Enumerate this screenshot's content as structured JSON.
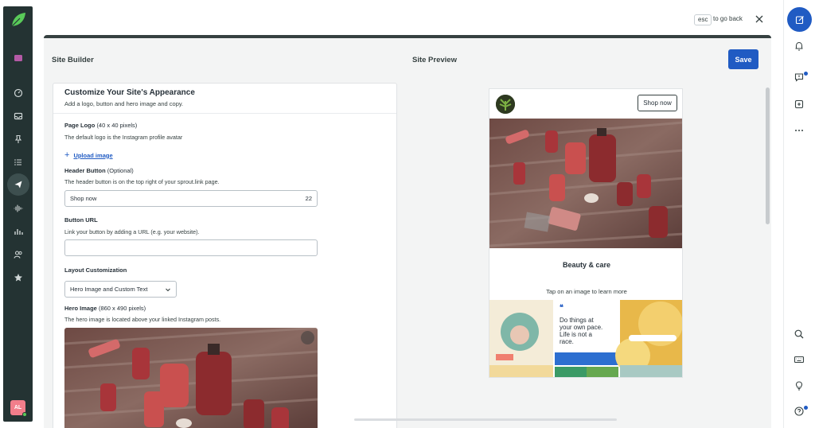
{
  "window": {
    "esc_key": "esc",
    "go_back": "to go back"
  },
  "colors": {
    "nav_bg": "#243333",
    "brand_green": "#59cb59",
    "primary_blue": "#205bc3"
  },
  "left_nav": {
    "items": [
      {
        "name": "compose-folder-icon"
      },
      {
        "name": "dashboard-icon"
      },
      {
        "name": "inbox-icon"
      },
      {
        "name": "pin-icon"
      },
      {
        "name": "tasks-icon"
      },
      {
        "name": "publishing-icon"
      },
      {
        "name": "listening-icon"
      },
      {
        "name": "reports-icon"
      },
      {
        "name": "people-icon"
      },
      {
        "name": "reviews-icon"
      }
    ],
    "avatar_initials": "AL"
  },
  "builder": {
    "title": "Site Builder",
    "preview_title": "Site Preview",
    "save_label": "Save",
    "section_title": "Customize Your Site's Appearance",
    "section_subtitle": "Add a logo, button and hero image and copy.",
    "page_logo_label": "Page Logo",
    "page_logo_hint": "(40 x 40 pixels)",
    "page_logo_help": "The default logo is the Instagram profile avatar",
    "upload_label": "Upload image",
    "header_button_label": "Header Button",
    "header_button_opt": "(Optional)",
    "header_button_help": "The header button is on the top right of your sprout.link page.",
    "header_button_value": "Shop now",
    "header_button_count": "22",
    "button_url_label": "Button URL",
    "button_url_help": "Link your button by adding a URL (e.g. your website).",
    "button_url_value": "",
    "layout_label": "Layout Customization",
    "layout_value": "Hero Image and Custom Text",
    "hero_label": "Hero Image",
    "hero_hint": "(860 x 490 pixels)",
    "hero_help": "The hero image is located above your linked Instagram posts."
  },
  "preview": {
    "shop_label": "Shop now",
    "title": "Beauty & care",
    "tap_text": "Tap on an image to learn more",
    "quote_text_1": "Do things at",
    "quote_text_2": "your own pace.",
    "quote_text_3": "Life is not a",
    "quote_text_4": "race."
  }
}
